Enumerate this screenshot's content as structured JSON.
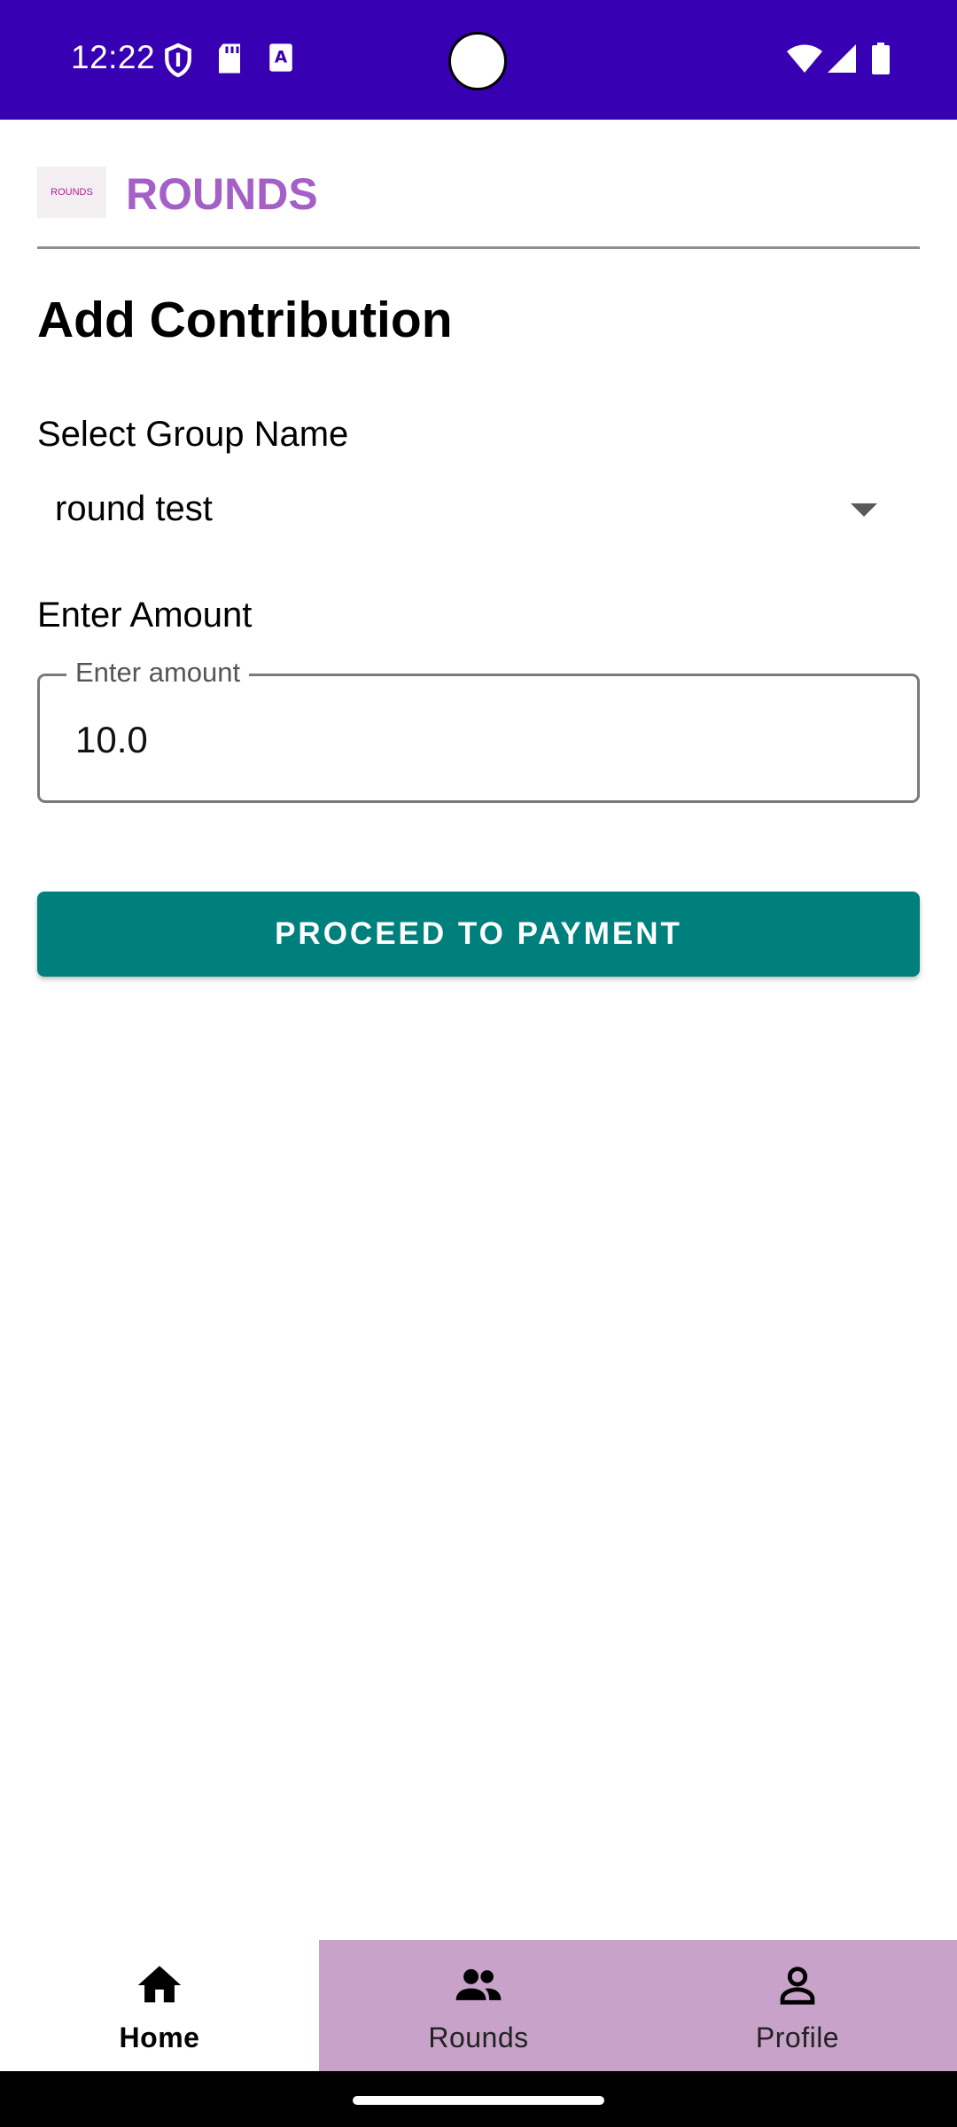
{
  "status_bar": {
    "time": "12:22",
    "left_icons": [
      "shield-icon",
      "sd-card-icon",
      "keyboard-a-icon"
    ],
    "right_icons": [
      "wifi-icon",
      "signal-icon",
      "battery-icon"
    ],
    "color": "#3700b3"
  },
  "header": {
    "logo_text": "ROUNDS",
    "app_title": "ROUNDS",
    "title_color": "#a560c8"
  },
  "page": {
    "title": "Add Contribution"
  },
  "group_select": {
    "label": "Select Group Name",
    "selected_value": "round test"
  },
  "amount": {
    "label": "Enter Amount",
    "field_label": "Enter amount",
    "value": "10.0"
  },
  "actions": {
    "proceed_label": "PROCEED TO PAYMENT",
    "button_color": "#00807d"
  },
  "bottom_nav": {
    "items": [
      {
        "label": "Home",
        "icon": "home-icon",
        "active": true
      },
      {
        "label": "Rounds",
        "icon": "group-icon",
        "active": false
      },
      {
        "label": "Profile",
        "icon": "person-icon",
        "active": false
      }
    ],
    "inactive_color": "#c8a2c8"
  }
}
